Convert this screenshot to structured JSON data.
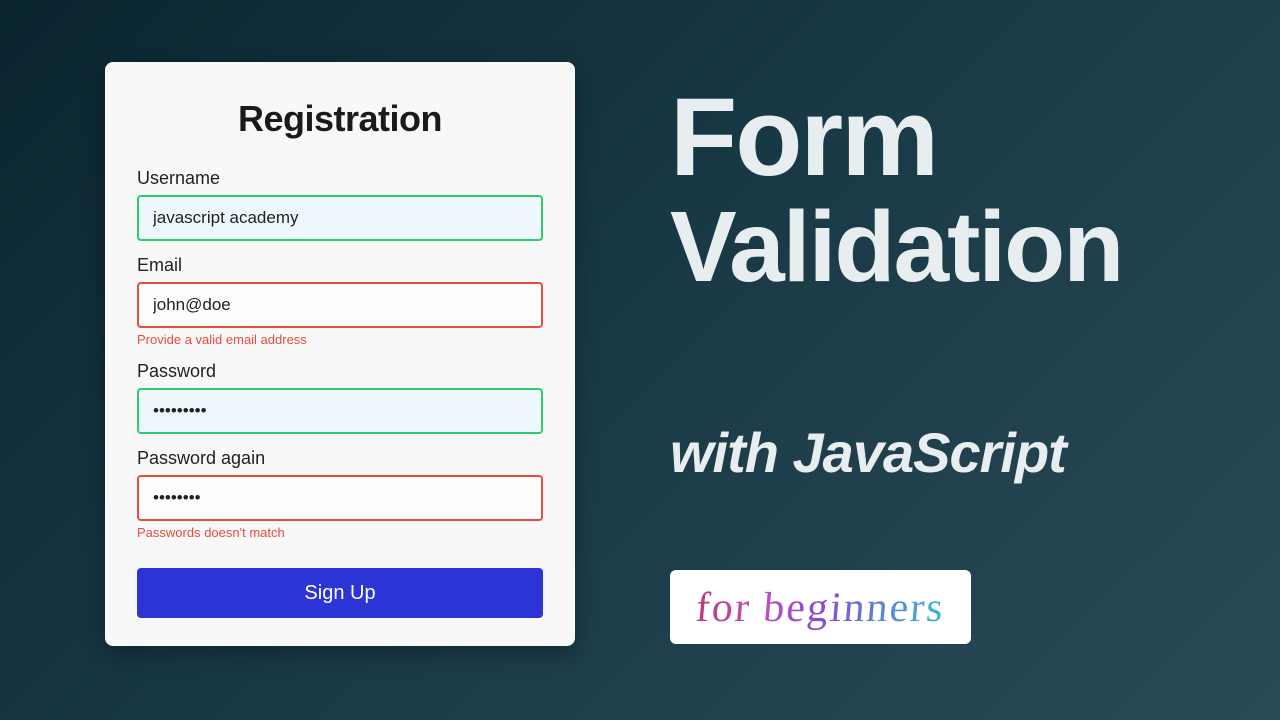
{
  "form": {
    "title": "Registration",
    "username": {
      "label": "Username",
      "value": "javascript academy"
    },
    "email": {
      "label": "Email",
      "value": "john@doe",
      "error": "Provide a valid email address"
    },
    "password": {
      "label": "Password",
      "value": "•••••••••"
    },
    "password2": {
      "label": "Password again",
      "value": "••••••••",
      "error": "Passwords doesn't match"
    },
    "submit_label": "Sign Up"
  },
  "headline": {
    "line1": "Form",
    "line2": "Validation"
  },
  "subheadline": "with JavaScript",
  "badge": "for beginners"
}
